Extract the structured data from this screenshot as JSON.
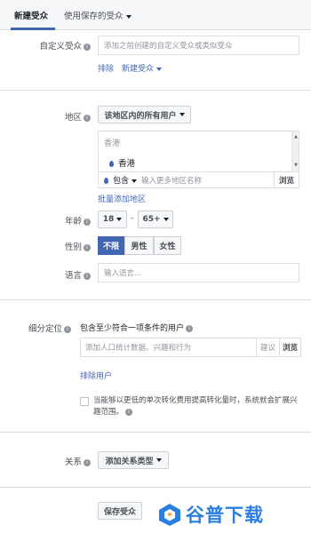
{
  "tabs": [
    {
      "label": "新建受众",
      "active": true
    },
    {
      "label": "使用保存的受众",
      "active": false
    }
  ],
  "custom_audience": {
    "label": "自定义受众",
    "placeholder": "添加之前创建的自定义受众或类似受众",
    "exclude_link": "排除",
    "create_link": "新建受众"
  },
  "location": {
    "label": "地区",
    "dropdown": "该地区内的所有用户",
    "country": "香港",
    "selected_item": "香港",
    "include_label": "包含",
    "search_placeholder": "输入更多地区名称",
    "browse_label": "浏览",
    "bulk_add_link": "批量添加地区"
  },
  "age": {
    "label": "年龄",
    "min": "18",
    "separator": "-",
    "max": "65+"
  },
  "gender": {
    "label": "性别",
    "options": [
      "不限",
      "男性",
      "女性"
    ],
    "selected": "不限"
  },
  "language": {
    "label": "语言",
    "placeholder": "输入语言..."
  },
  "detailed_targeting": {
    "label": "细分定位",
    "description": "包含至少符合一项条件的用户",
    "placeholder": "添加人口统计数据、兴趣和行为",
    "suggest_label": "建议",
    "browse_label": "浏览",
    "exclude_link": "排除用户",
    "expansion_text": "当能够以更低的单次转化费用提高转化量时，系统就会扩展兴趣范围。",
    "expansion_checked": false
  },
  "connections": {
    "label": "关系",
    "dropdown": "添加关系类型"
  },
  "save_button": "保存受众",
  "watermark": "谷普下载",
  "colors": {
    "accent": "#4267b2",
    "watermark": "#2a7de1",
    "border": "#dddfe2"
  }
}
